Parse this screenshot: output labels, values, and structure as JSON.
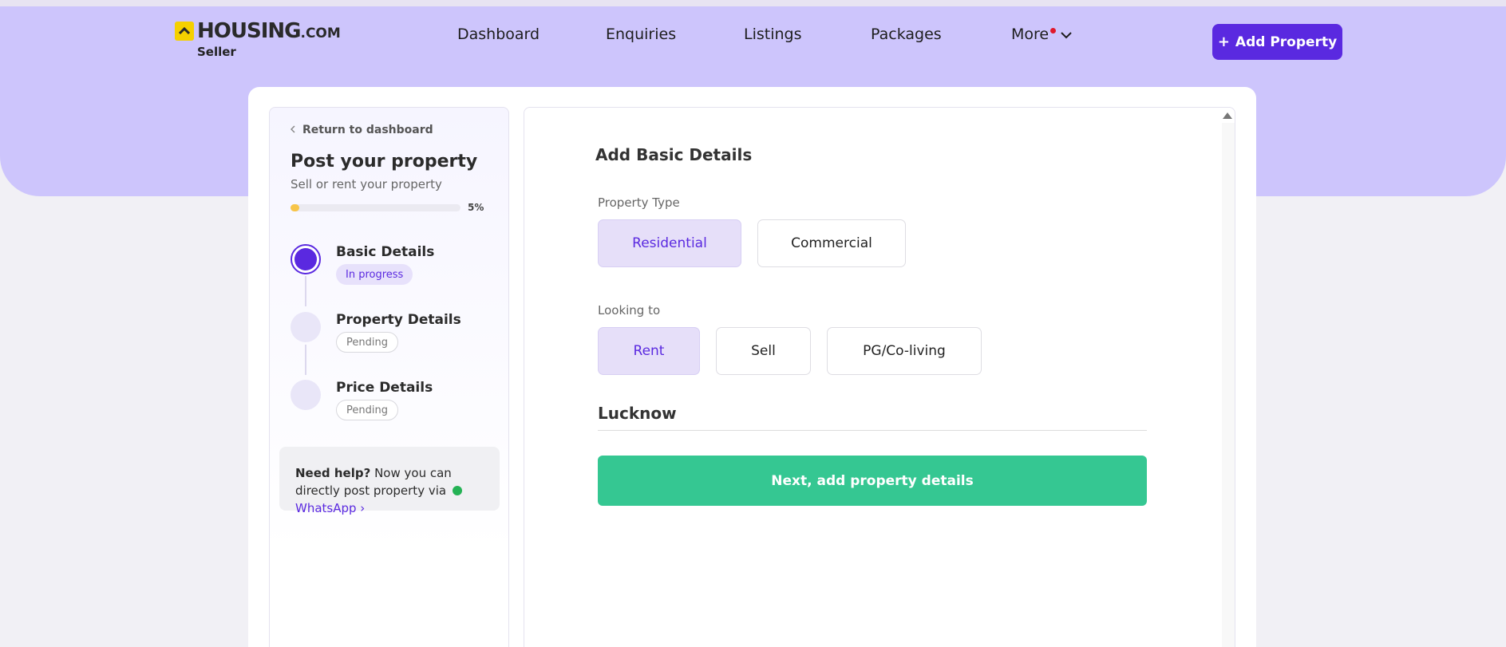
{
  "brand": {
    "name": "HOUSING",
    "domain": ".COM",
    "subtitle": "Seller"
  },
  "nav": {
    "items": [
      "Dashboard",
      "Enquiries",
      "Listings",
      "Packages"
    ],
    "more_label": "More",
    "add_property_label": "Add Property"
  },
  "sidebar": {
    "back_label": "Return to dashboard",
    "title": "Post your property",
    "subtitle": "Sell or rent your property",
    "progress": {
      "value": 5,
      "label": "5%"
    },
    "steps": [
      {
        "title": "Basic Details",
        "status": "In progress"
      },
      {
        "title": "Property Details",
        "status": "Pending"
      },
      {
        "title": "Price Details",
        "status": "Pending"
      }
    ],
    "help": {
      "bold": "Need help?",
      "text": "Now you can directly post property via",
      "link": "WhatsApp"
    }
  },
  "form": {
    "title": "Add Basic Details",
    "property_type": {
      "label": "Property Type",
      "options": [
        "Residential",
        "Commercial"
      ],
      "selected": "Residential"
    },
    "looking_to": {
      "label": "Looking to",
      "options": [
        "Rent",
        "Sell",
        "PG/Co-living"
      ],
      "selected": "Rent"
    },
    "city": "Lucknow",
    "next_label": "Next, add property details"
  },
  "colors": {
    "accent": "#5a29e0",
    "header_bg": "#cdc5fc",
    "cta_green": "#35c792",
    "progress_yellow": "#f7c54a"
  }
}
